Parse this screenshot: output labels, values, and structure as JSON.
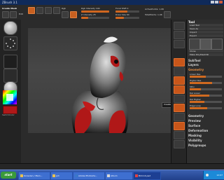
{
  "window": {
    "title": "ZBrush 3.1"
  },
  "top_toolbar": {
    "menu_label": "Create Mesh",
    "edit_label": "Edit",
    "rgb_label": "Rgb",
    "rgb_intensity_label": "Rgb Intensity 100",
    "z_intensity_label": "Z Intensity 25",
    "focal_label": "Focal Shift 0",
    "draw_size_label": "Draw Size 64",
    "active_points_label": "ActivePoints: 1.06",
    "total_points_label": "TotalPoints: 1.06"
  },
  "tooltip": {
    "label": "Create Edge"
  },
  "tool_panel": {
    "title": "Tool",
    "load_label": "Load Tool",
    "save_label": "Save As",
    "import_label": "Import",
    "export_label": "Export",
    "clone_label": "Clone",
    "make_label": "Make PolyMesh3D",
    "subtools_label": "SubTool",
    "layers_label": "Layers",
    "geometry_label": "Geometry",
    "sections": [
      {
        "label": "Geometry"
      },
      {
        "label": "Preview"
      },
      {
        "label": "Surface"
      },
      {
        "label": "Deformation"
      },
      {
        "label": "Masking"
      },
      {
        "label": "Visibility"
      },
      {
        "label": "Polygroups"
      }
    ],
    "sliders": [
      {
        "label": "Lower Res",
        "fill": 0.5
      },
      {
        "label": "Higher Res",
        "fill": 0.7
      },
      {
        "label": "SDiv",
        "fill": 0.35
      },
      {
        "label": "Del Lower",
        "fill": 0.6
      },
      {
        "label": "Del Higher",
        "fill": 0.45
      },
      {
        "label": "Edge Loop",
        "fill": 0.55
      }
    ]
  },
  "left_shelf": {
    "color_label": "SwitchColor"
  },
  "taskbar": {
    "start_label": "start",
    "items": [
      {
        "label": "Konsolen / Mein..."
      },
      {
        "label": "pct"
      },
      {
        "label": "Adobe Photosho..."
      },
      {
        "label": "Album"
      },
      {
        "label": "Bild-14.pad"
      }
    ],
    "clock": "12:07"
  },
  "colors": {
    "accent": "#d0661f",
    "taskbar": "#2a4fa8",
    "model_red": "#b01818"
  }
}
